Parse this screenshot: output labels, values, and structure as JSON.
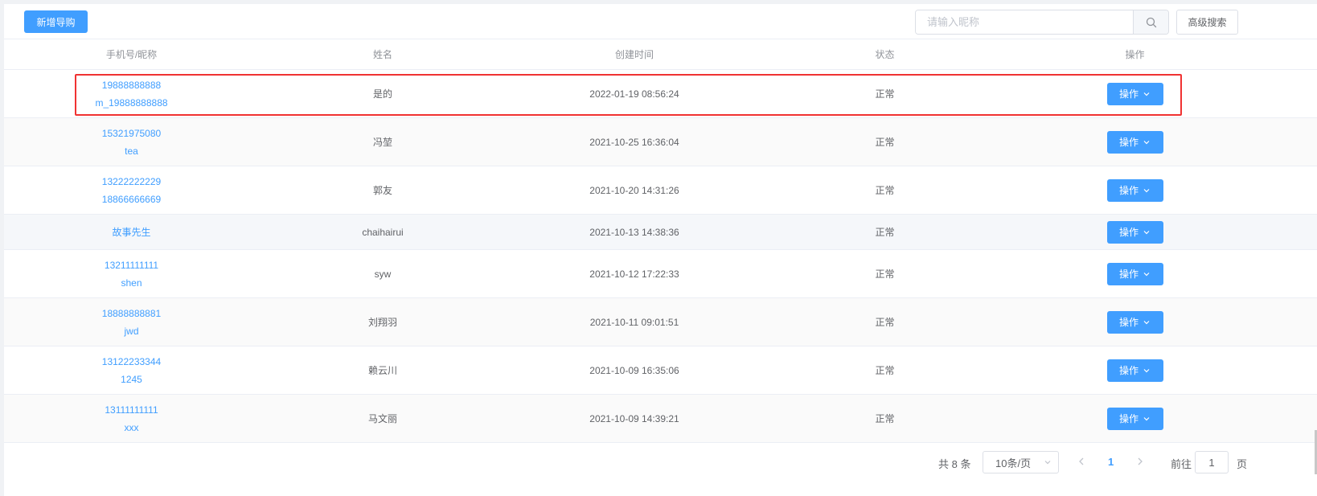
{
  "toolbar": {
    "add_label": "新增导购",
    "search_placeholder": "请输入昵称",
    "advanced_label": "高级搜索"
  },
  "table": {
    "headers": [
      "手机号/昵称",
      "姓名",
      "创建时间",
      "状态",
      "操作"
    ],
    "rows": [
      {
        "phone": "19888888888",
        "nick": "m_19888888888",
        "name": "是的",
        "created": "2022-01-19 08:56:24",
        "status": "正常",
        "action": "操作"
      },
      {
        "phone": "15321975080",
        "nick": "tea",
        "name": "冯堃",
        "created": "2021-10-25 16:36:04",
        "status": "正常",
        "action": "操作"
      },
      {
        "phone": "13222222229",
        "nick": "18866666669",
        "name": "郭友",
        "created": "2021-10-20 14:31:26",
        "status": "正常",
        "action": "操作"
      },
      {
        "phone": "故事先生",
        "nick": "",
        "name": "chaihairui",
        "created": "2021-10-13 14:38:36",
        "status": "正常",
        "action": "操作"
      },
      {
        "phone": "13211111111",
        "nick": "shen",
        "name": "syw",
        "created": "2021-10-12 17:22:33",
        "status": "正常",
        "action": "操作"
      },
      {
        "phone": "18888888881",
        "nick": "jwd",
        "name": "刘翔羽",
        "created": "2021-10-11 09:01:51",
        "status": "正常",
        "action": "操作"
      },
      {
        "phone": "13122233344",
        "nick": "1245",
        "name": "赖云川",
        "created": "2021-10-09 16:35:06",
        "status": "正常",
        "action": "操作"
      },
      {
        "phone": "13111111111",
        "nick": "xxx",
        "name": "马文丽",
        "created": "2021-10-09 14:39:21",
        "status": "正常",
        "action": "操作"
      }
    ]
  },
  "pagination": {
    "total": "共 8 条",
    "page_size": "10条/页",
    "current_page": "1",
    "goto_label": "前往",
    "goto_value": "1",
    "page_unit": "页"
  },
  "colors": {
    "primary": "#409eff",
    "highlight": "#f03232"
  },
  "icons": {
    "search": "search-icon",
    "chevron": "chevron-down-icon",
    "prev": "chevron-left-icon",
    "next": "chevron-right-icon"
  }
}
